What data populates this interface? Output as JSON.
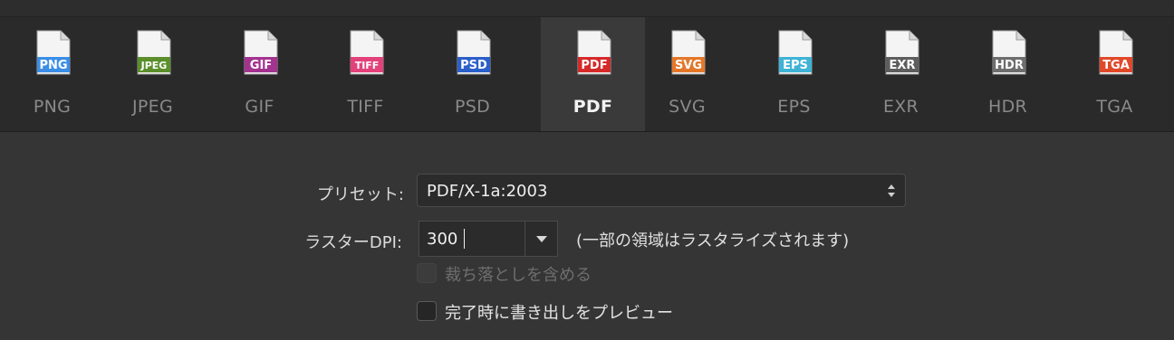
{
  "formats": [
    {
      "label": "PNG",
      "badge": "PNG",
      "color": "#3b8ee6",
      "active": false
    },
    {
      "label": "JPEG",
      "badge": "JPEG",
      "color": "#5a8f2c",
      "active": false
    },
    {
      "label": "GIF",
      "badge": "GIF",
      "color": "#a3338f",
      "active": false
    },
    {
      "label": "TIFF",
      "badge": "TIFF",
      "color": "#e3417a",
      "active": false
    },
    {
      "label": "PSD",
      "badge": "PSD",
      "color": "#2b5fc9",
      "active": false
    },
    {
      "label": "PDF",
      "badge": "PDF",
      "color": "#d52a2a",
      "active": true
    },
    {
      "label": "SVG",
      "badge": "SVG",
      "color": "#e3782b",
      "active": false
    },
    {
      "label": "EPS",
      "badge": "EPS",
      "color": "#3fb3d6",
      "active": false
    },
    {
      "label": "EXR",
      "badge": "EXR",
      "color": "#5e5e5e",
      "active": false
    },
    {
      "label": "HDR",
      "badge": "HDR",
      "color": "#6e6e6e",
      "active": false
    },
    {
      "label": "TGA",
      "badge": "TGA",
      "color": "#e0482a",
      "active": false
    }
  ],
  "preset": {
    "label": "プリセット:",
    "value": "PDF/X-1a:2003"
  },
  "raster": {
    "label": "ラスターDPI:",
    "value": "300",
    "note": "(一部の領域はラスタライズされます)"
  },
  "checkboxes": {
    "bleed": {
      "label": "裁ち落としを含める",
      "enabled": false,
      "checked": false
    },
    "preview": {
      "label": "完了時に書き出しをプレビュー",
      "enabled": true,
      "checked": false
    }
  }
}
